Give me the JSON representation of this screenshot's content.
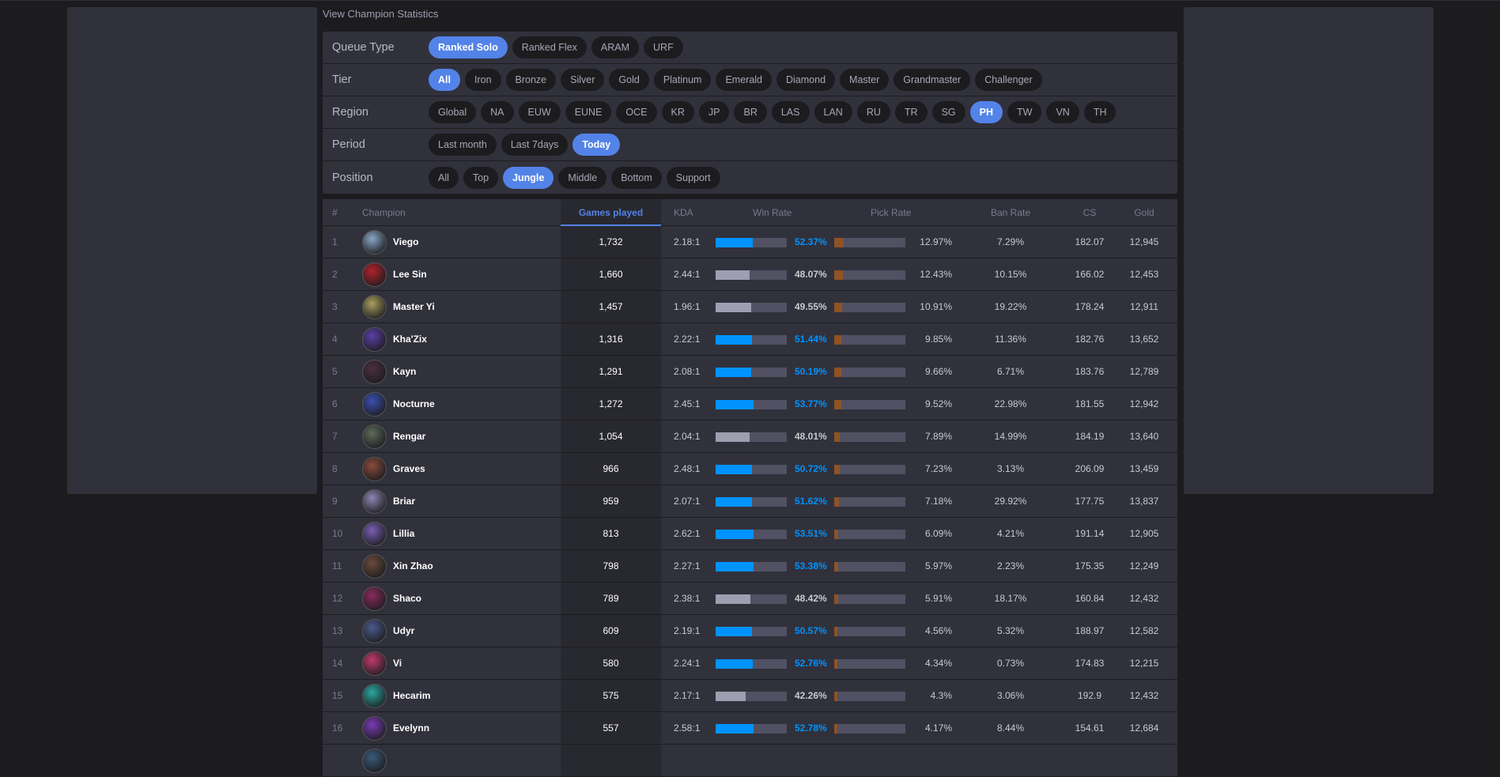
{
  "page": {
    "title": "View Champion Statistics"
  },
  "colors": {
    "accent": "#5383e8",
    "win_high": "#0093ff",
    "win_low": "#9e9eb1",
    "pick_bar": "#8e5325",
    "panel": "#31313c",
    "background": "#1c1c1f"
  },
  "filters": [
    {
      "label": "Queue Type",
      "options": [
        "Ranked Solo",
        "Ranked Flex",
        "ARAM",
        "URF"
      ],
      "selected": "Ranked Solo"
    },
    {
      "label": "Tier",
      "options": [
        "All",
        "Iron",
        "Bronze",
        "Silver",
        "Gold",
        "Platinum",
        "Emerald",
        "Diamond",
        "Master",
        "Grandmaster",
        "Challenger"
      ],
      "selected": "All"
    },
    {
      "label": "Region",
      "options": [
        "Global",
        "NA",
        "EUW",
        "EUNE",
        "OCE",
        "KR",
        "JP",
        "BR",
        "LAS",
        "LAN",
        "RU",
        "TR",
        "SG",
        "PH",
        "TW",
        "VN",
        "TH"
      ],
      "selected": "PH"
    },
    {
      "label": "Period",
      "options": [
        "Last month",
        "Last 7days",
        "Today"
      ],
      "selected": "Today"
    },
    {
      "label": "Position",
      "options": [
        "All",
        "Top",
        "Jungle",
        "Middle",
        "Bottom",
        "Support"
      ],
      "selected": "Jungle"
    }
  ],
  "table": {
    "headers": {
      "rank": "#",
      "champion": "Champion",
      "games": "Games played",
      "kda": "KDA",
      "win_rate": "Win Rate",
      "pick_rate": "Pick Rate",
      "ban_rate": "Ban Rate",
      "cs": "CS",
      "gold": "Gold"
    },
    "rows": [
      {
        "rank": "1",
        "name": "Viego",
        "games": "1,732",
        "kda": "2.18:1",
        "win_rate": "52.37%",
        "win_value": 52.37,
        "pick_rate": "12.97%",
        "pick_value": 12.97,
        "ban_rate": "7.29%",
        "cs": "182.07",
        "gold": "12,945",
        "avatar_color": "#8aa7c6"
      },
      {
        "rank": "2",
        "name": "Lee Sin",
        "games": "1,660",
        "kda": "2.44:1",
        "win_rate": "48.07%",
        "win_value": 48.07,
        "pick_rate": "12.43%",
        "pick_value": 12.43,
        "ban_rate": "10.15%",
        "cs": "166.02",
        "gold": "12,453",
        "avatar_color": "#b2222b"
      },
      {
        "rank": "3",
        "name": "Master Yi",
        "games": "1,457",
        "kda": "1.96:1",
        "win_rate": "49.55%",
        "win_value": 49.55,
        "pick_rate": "10.91%",
        "pick_value": 10.91,
        "ban_rate": "19.22%",
        "cs": "178.24",
        "gold": "12,911",
        "avatar_color": "#a89e5c"
      },
      {
        "rank": "4",
        "name": "Kha'Zix",
        "games": "1,316",
        "kda": "2.22:1",
        "win_rate": "51.44%",
        "win_value": 51.44,
        "pick_rate": "9.85%",
        "pick_value": 9.85,
        "ban_rate": "11.36%",
        "cs": "182.76",
        "gold": "13,652",
        "avatar_color": "#5b3fa8"
      },
      {
        "rank": "5",
        "name": "Kayn",
        "games": "1,291",
        "kda": "2.08:1",
        "win_rate": "50.19%",
        "win_value": 50.19,
        "pick_rate": "9.66%",
        "pick_value": 9.66,
        "ban_rate": "6.71%",
        "cs": "183.76",
        "gold": "12,789",
        "avatar_color": "#4a2f3f"
      },
      {
        "rank": "6",
        "name": "Nocturne",
        "games": "1,272",
        "kda": "2.45:1",
        "win_rate": "53.77%",
        "win_value": 53.77,
        "pick_rate": "9.52%",
        "pick_value": 9.52,
        "ban_rate": "22.98%",
        "cs": "181.55",
        "gold": "12,942",
        "avatar_color": "#3a4fb0"
      },
      {
        "rank": "7",
        "name": "Rengar",
        "games": "1,054",
        "kda": "2.04:1",
        "win_rate": "48.01%",
        "win_value": 48.01,
        "pick_rate": "7.89%",
        "pick_value": 7.89,
        "ban_rate": "14.99%",
        "cs": "184.19",
        "gold": "13,640",
        "avatar_color": "#5d6a5a"
      },
      {
        "rank": "8",
        "name": "Graves",
        "games": "966",
        "kda": "2.48:1",
        "win_rate": "50.72%",
        "win_value": 50.72,
        "pick_rate": "7.23%",
        "pick_value": 7.23,
        "ban_rate": "3.13%",
        "cs": "206.09",
        "gold": "13,459",
        "avatar_color": "#8a4a3a"
      },
      {
        "rank": "9",
        "name": "Briar",
        "games": "959",
        "kda": "2.07:1",
        "win_rate": "51.62%",
        "win_value": 51.62,
        "pick_rate": "7.18%",
        "pick_value": 7.18,
        "ban_rate": "29.92%",
        "cs": "177.75",
        "gold": "13,837",
        "avatar_color": "#8e86b5"
      },
      {
        "rank": "10",
        "name": "Lillia",
        "games": "813",
        "kda": "2.62:1",
        "win_rate": "53.51%",
        "win_value": 53.51,
        "pick_rate": "6.09%",
        "pick_value": 6.09,
        "ban_rate": "4.21%",
        "cs": "191.14",
        "gold": "12,905",
        "avatar_color": "#7a5fb5"
      },
      {
        "rank": "11",
        "name": "Xin Zhao",
        "games": "798",
        "kda": "2.27:1",
        "win_rate": "53.38%",
        "win_value": 53.38,
        "pick_rate": "5.97%",
        "pick_value": 5.97,
        "ban_rate": "2.23%",
        "cs": "175.35",
        "gold": "12,249",
        "avatar_color": "#6b4a3a"
      },
      {
        "rank": "12",
        "name": "Shaco",
        "games": "789",
        "kda": "2.38:1",
        "win_rate": "48.42%",
        "win_value": 48.42,
        "pick_rate": "5.91%",
        "pick_value": 5.91,
        "ban_rate": "18.17%",
        "cs": "160.84",
        "gold": "12,432",
        "avatar_color": "#8a2a5a"
      },
      {
        "rank": "13",
        "name": "Udyr",
        "games": "609",
        "kda": "2.19:1",
        "win_rate": "50.57%",
        "win_value": 50.57,
        "pick_rate": "4.56%",
        "pick_value": 4.56,
        "ban_rate": "5.32%",
        "cs": "188.97",
        "gold": "12,582",
        "avatar_color": "#4a5a8a"
      },
      {
        "rank": "14",
        "name": "Vi",
        "games": "580",
        "kda": "2.24:1",
        "win_rate": "52.76%",
        "win_value": 52.76,
        "pick_rate": "4.34%",
        "pick_value": 4.34,
        "ban_rate": "0.73%",
        "cs": "174.83",
        "gold": "12,215",
        "avatar_color": "#c23a6a"
      },
      {
        "rank": "15",
        "name": "Hecarim",
        "games": "575",
        "kda": "2.17:1",
        "win_rate": "42.26%",
        "win_value": 42.26,
        "pick_rate": "4.3%",
        "pick_value": 4.3,
        "ban_rate": "3.06%",
        "cs": "192.9",
        "gold": "12,432",
        "avatar_color": "#2aa8a0"
      },
      {
        "rank": "16",
        "name": "Evelynn",
        "games": "557",
        "kda": "2.58:1",
        "win_rate": "52.78%",
        "win_value": 52.78,
        "pick_rate": "4.17%",
        "pick_value": 4.17,
        "ban_rate": "8.44%",
        "cs": "154.61",
        "gold": "12,684",
        "avatar_color": "#7a3ab5"
      },
      {
        "rank": "",
        "name": "",
        "games": "",
        "kda": "",
        "win_rate": "",
        "win_value": 0,
        "pick_rate": "",
        "pick_value": 0,
        "ban_rate": "",
        "cs": "",
        "gold": "",
        "avatar_color": "#3a5a7a"
      }
    ]
  }
}
